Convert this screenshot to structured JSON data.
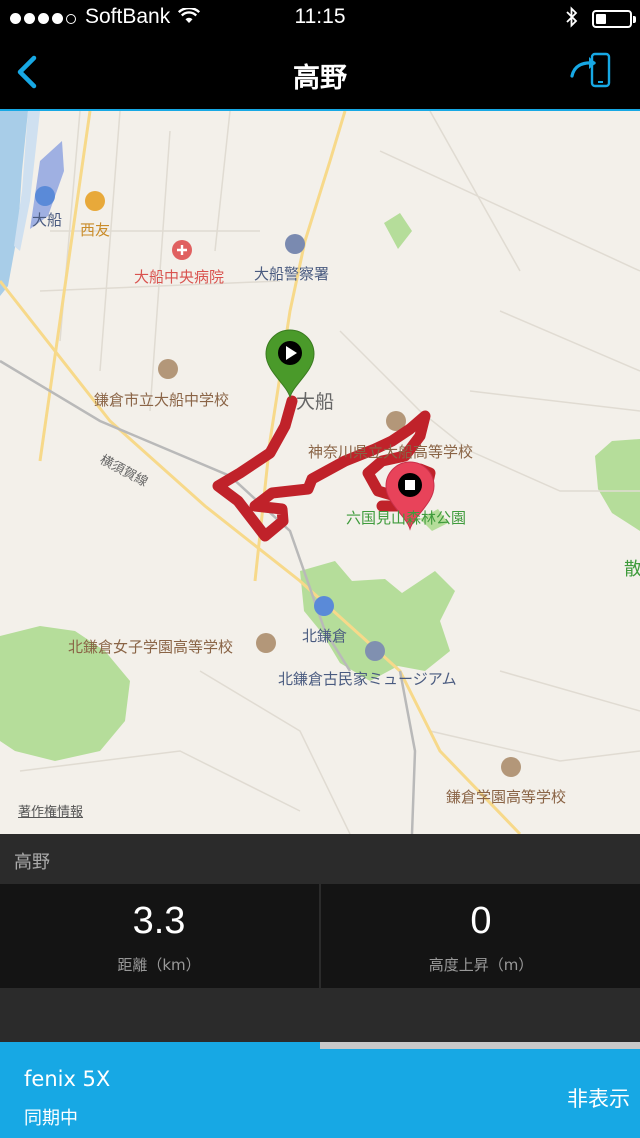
{
  "status_bar": {
    "carrier": "SoftBank",
    "time": "11:15",
    "signal_bars": 4,
    "battery_level": 0.3
  },
  "nav": {
    "title": "高野",
    "back_icon": "chevron-left-icon",
    "share_icon": "export-to-device-icon",
    "accent_color": "#17a8e4"
  },
  "map": {
    "labels": {
      "ofuna_station": "大船",
      "seiyu": "西友",
      "ofuna_hospital": "大船中央病院",
      "police": "大船警察署",
      "junior_high": "鎌倉市立大船中学校",
      "district": "大船",
      "yokosuka_line": "横須賀線",
      "high_school": "神奈川県立大船高等学校",
      "park": "六国見山森林公園",
      "kitakamakura_station": "北鎌倉",
      "girls_school": "北鎌倉女子学園高等学校",
      "museum": "北鎌倉古民家ミュージアム",
      "gakuen": "鎌倉学園高等学校",
      "edge_text": "散"
    },
    "copyright": "著作権情報",
    "route_color": "#c0222a",
    "start_marker_color": "#4a9a2a",
    "end_marker_color": "#e8435a"
  },
  "activity": {
    "name": "高野",
    "distance": {
      "value": "3.3",
      "label": "距離（km）"
    },
    "elevation": {
      "value": "0",
      "label": "高度上昇（m）"
    }
  },
  "sync": {
    "device": "fenix 5X",
    "status": "同期中",
    "hide_label": "非表示",
    "progress": 0.5
  }
}
